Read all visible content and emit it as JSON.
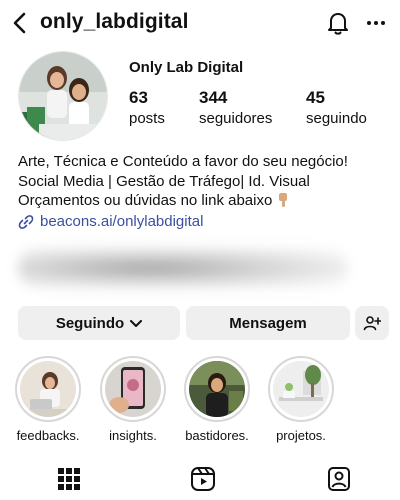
{
  "header": {
    "username": "only_labdigital",
    "back_icon": "chevron-left-icon",
    "bell_icon": "bell-icon",
    "more_icon": "more-horizontal-icon"
  },
  "profile": {
    "display_name": "Only Lab Digital",
    "stats": [
      {
        "value": "63",
        "label": "posts"
      },
      {
        "value": "344",
        "label": "seguidores"
      },
      {
        "value": "45",
        "label": "seguindo"
      }
    ],
    "bio_lines": [
      "Arte, Técnica e Conteúdo a favor do seu negócio!",
      "Social Media | Gestão de Tráfego| Id. Visual",
      "Orçamentos ou dúvidas no link abaixo"
    ],
    "link": "beacons.ai/onlylabdigital"
  },
  "actions": {
    "following_label": "Seguindo",
    "message_label": "Mensagem"
  },
  "highlights": [
    {
      "label": "feedbacks."
    },
    {
      "label": "insights."
    },
    {
      "label": "bastidores."
    },
    {
      "label": "projetos."
    }
  ],
  "tabs": [
    "grid-icon",
    "reels-icon",
    "tagged-icon"
  ],
  "colors": {
    "link": "#3a4fa3",
    "button_bg": "#efefef",
    "ring": "#d7d7d7"
  }
}
